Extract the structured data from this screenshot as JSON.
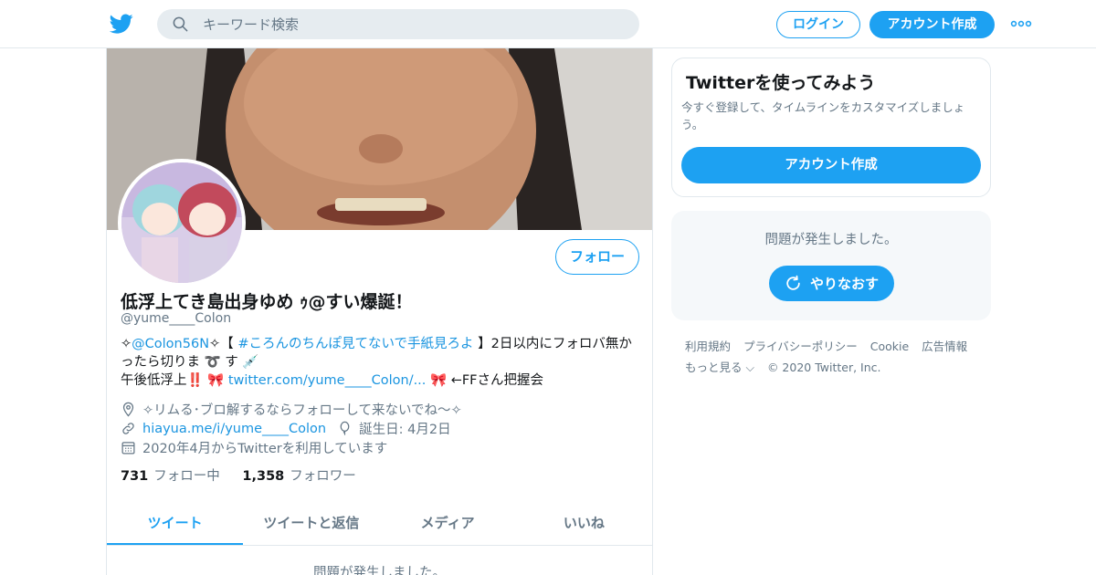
{
  "header": {
    "search_placeholder": "キーワード検索",
    "login_label": "ログイン",
    "signup_label": "アカウント作成"
  },
  "profile": {
    "follow_label": "フォロー",
    "display_name": "低浮上てき島出身ゆめ ｩ@すい爆誕！",
    "handle": "@yume____Colon",
    "bio_line1_a": "✧",
    "bio_line1_mention": "@Colon56N",
    "bio_line1_b": "✧【 ",
    "bio_line1_hashtag": "#ころんのちんぽ見てないで手紙見ろよ",
    "bio_line1_c": " 】2日以内にフォロバ無か",
    "bio_line2": "ったら切りま ➰ す 💉",
    "bio_line3_a": "午後低浮上‼️ 🎀 ",
    "bio_line3_link": "twitter.com/yume____Colon/...",
    "bio_line3_b": " 🎀 ←FFさん把握会",
    "location": "✧リムる･ブロ解するならフォローして来ないでね〜✧",
    "website": "hiayua.me/i/yume____Colon",
    "birthday": "誕生日: 4月2日",
    "joined": "2020年4月からTwitterを利用しています",
    "following_count": "731",
    "following_label": "フォロー中",
    "followers_count": "1,358",
    "followers_label": "フォロワー"
  },
  "tabs": [
    {
      "label": "ツイート",
      "active": true
    },
    {
      "label": "ツイートと返信",
      "active": false
    },
    {
      "label": "メディア",
      "active": false
    },
    {
      "label": "いいね",
      "active": false
    }
  ],
  "timeline_error": "問題が発生しました。",
  "sidebar": {
    "signup_title": "Twitterを使ってみよう",
    "signup_text": "今すぐ登録して、タイムラインをカスタマイズしましょう。",
    "signup_button": "アカウント作成",
    "error_text": "問題が発生しました。",
    "retry_label": "やりなおす"
  },
  "footer": {
    "terms": "利用規約",
    "privacy": "プライバシーポリシー",
    "cookie": "Cookie",
    "ads": "広告情報",
    "more": "もっと見る ⌵",
    "copyright": "© 2020 Twitter, Inc."
  },
  "colors": {
    "accent": "#1da1f2",
    "secondary_text": "#657786",
    "border": "#e1e8ed"
  }
}
